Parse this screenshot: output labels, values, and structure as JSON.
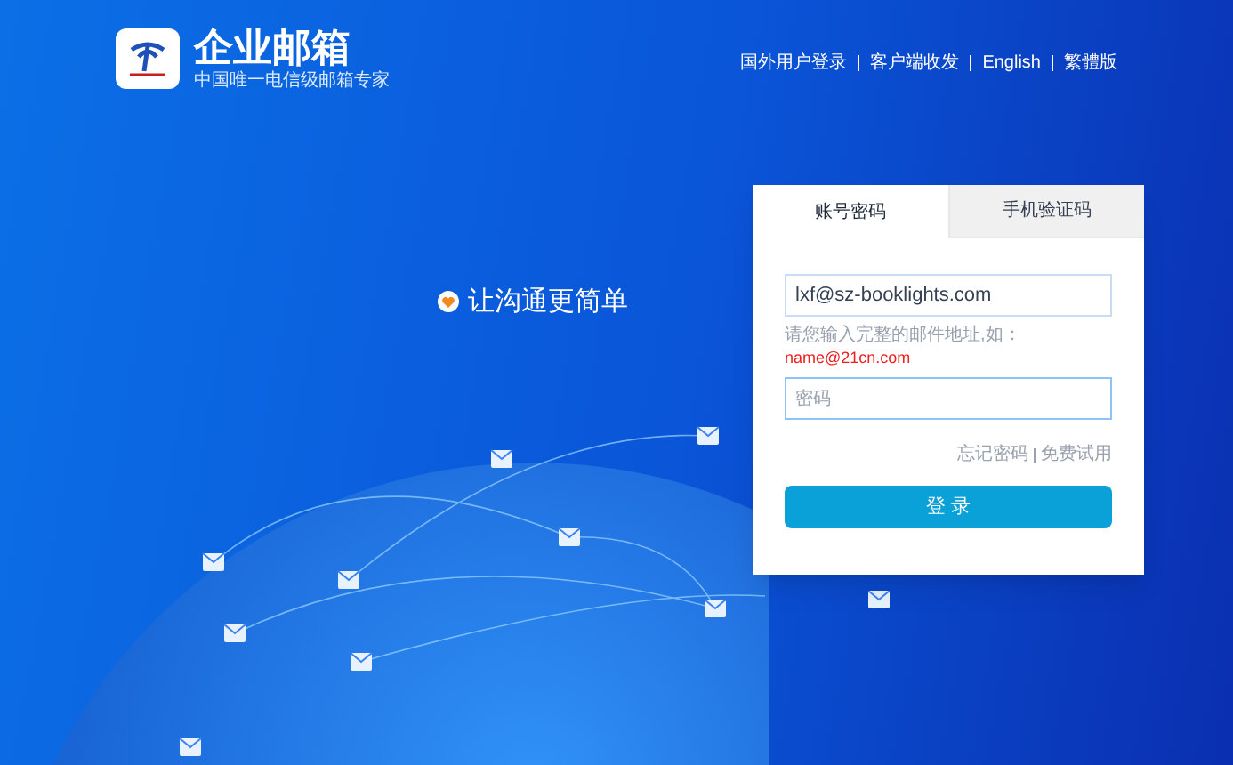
{
  "brand": {
    "title": "企业邮箱",
    "subtitle": "中国唯一电信级邮箱专家"
  },
  "nav": [
    {
      "label": "国外用户登录"
    },
    {
      "label": "客户端收发"
    },
    {
      "label": "English"
    },
    {
      "label": "繁體版"
    }
  ],
  "slogan": "让沟通更简单",
  "login": {
    "tabs": [
      {
        "label": "账号密码",
        "selected": true
      },
      {
        "label": "手机验证码",
        "selected": false
      }
    ],
    "account": {
      "value": "lxf@sz-booklights.com"
    },
    "hint": "请您输入完整的邮件地址,如：",
    "hint_example": "name@21cn.com",
    "password": {
      "placeholder": "密码"
    },
    "links": [
      {
        "label": "忘记密码"
      },
      {
        "label": "免费试用"
      }
    ],
    "submit": "登 录"
  }
}
